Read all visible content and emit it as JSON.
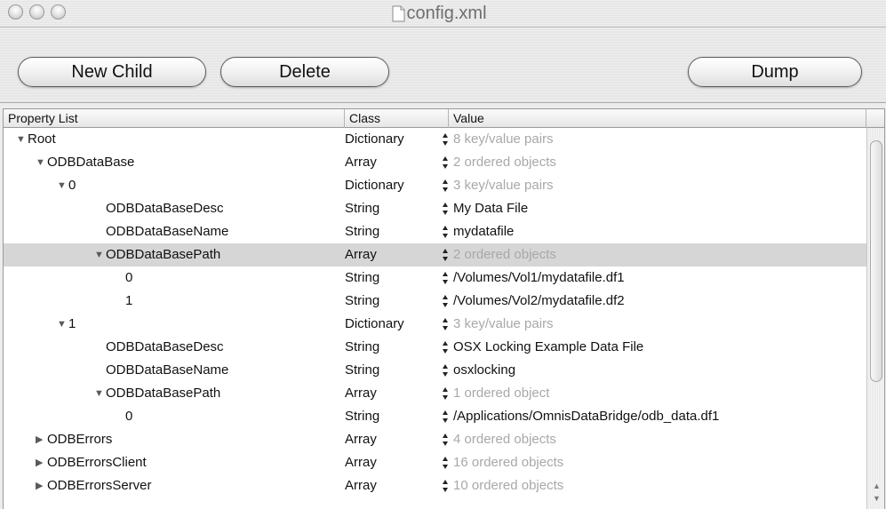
{
  "window": {
    "title": "config.xml"
  },
  "toolbar": {
    "new_child_label": "New Child",
    "delete_label": "Delete",
    "dump_label": "Dump"
  },
  "columns": [
    "Property List",
    "Class",
    "Value"
  ],
  "rows": [
    {
      "level": 0,
      "name": "Root",
      "expander": "open",
      "class": "Dictionary",
      "value": "8 key/value pairs",
      "muted": true,
      "selected": false
    },
    {
      "level": 1,
      "name": "ODBDataBase",
      "expander": "open",
      "class": "Array",
      "value": "2 ordered objects",
      "muted": true,
      "selected": false
    },
    {
      "level": 2,
      "name": "0",
      "expander": "open",
      "class": "Dictionary",
      "value": "3 key/value pairs",
      "muted": true,
      "selected": false
    },
    {
      "level": 3,
      "name": "ODBDataBaseDesc",
      "expander": "none",
      "class": "String",
      "value": "My Data File",
      "muted": false,
      "selected": false
    },
    {
      "level": 3,
      "name": "ODBDataBaseName",
      "expander": "none",
      "class": "String",
      "value": "mydatafile",
      "muted": false,
      "selected": false
    },
    {
      "level": 3,
      "name": "ODBDataBasePath",
      "expander": "open",
      "class": "Array",
      "value": "2 ordered objects",
      "muted": true,
      "selected": true
    },
    {
      "level": 4,
      "name": "0",
      "expander": "none",
      "class": "String",
      "value": "/Volumes/Vol1/mydatafile.df1",
      "muted": false,
      "selected": false
    },
    {
      "level": 4,
      "name": "1",
      "expander": "none",
      "class": "String",
      "value": "/Volumes/Vol2/mydatafile.df2",
      "muted": false,
      "selected": false
    },
    {
      "level": 2,
      "name": "1",
      "expander": "open",
      "class": "Dictionary",
      "value": "3 key/value pairs",
      "muted": true,
      "selected": false
    },
    {
      "level": 3,
      "name": "ODBDataBaseDesc",
      "expander": "none",
      "class": "String",
      "value": "OSX Locking Example Data File",
      "muted": false,
      "selected": false
    },
    {
      "level": 3,
      "name": "ODBDataBaseName",
      "expander": "none",
      "class": "String",
      "value": "osxlocking",
      "muted": false,
      "selected": false
    },
    {
      "level": 3,
      "name": "ODBDataBasePath",
      "expander": "open",
      "class": "Array",
      "value": "1 ordered object",
      "muted": true,
      "selected": false
    },
    {
      "level": 4,
      "name": "0",
      "expander": "none",
      "class": "String",
      "value": "/Applications/OmnisDataBridge/odb_data.df1",
      "muted": false,
      "selected": false
    },
    {
      "level": 1,
      "name": "ODBErrors",
      "expander": "closed",
      "class": "Array",
      "value": "4 ordered objects",
      "muted": true,
      "selected": false
    },
    {
      "level": 1,
      "name": "ODBErrorsClient",
      "expander": "closed",
      "class": "Array",
      "value": "16 ordered objects",
      "muted": true,
      "selected": false
    },
    {
      "level": 1,
      "name": "ODBErrorsServer",
      "expander": "closed",
      "class": "Array",
      "value": "10 ordered objects",
      "muted": true,
      "selected": false
    }
  ],
  "icons": {
    "expand_open": "triangle-down",
    "expand_closed": "triangle-right",
    "value_stepper": "up-down-arrows",
    "document": "document-icon"
  },
  "colors": {
    "selection": "#d6d6d6",
    "muted_text": "#a8a8a8"
  }
}
